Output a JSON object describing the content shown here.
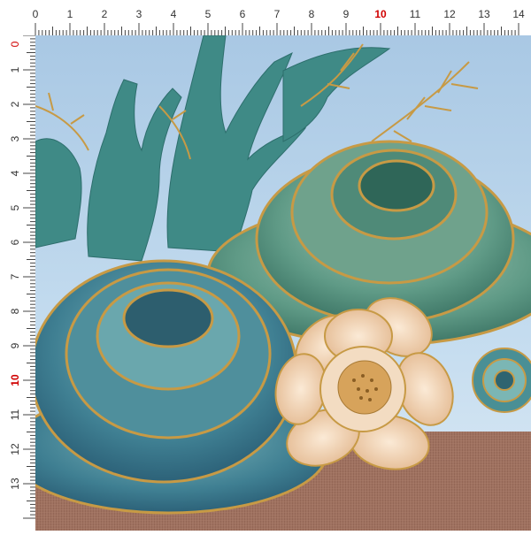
{
  "ruler": {
    "unit": "cm",
    "top_labels": [
      "0",
      "1",
      "2",
      "3",
      "4",
      "5",
      "6",
      "7",
      "8",
      "9",
      "10",
      "11",
      "12",
      "13",
      "14"
    ],
    "left_labels": [
      "0",
      "1",
      "2",
      "3",
      "4",
      "5",
      "6",
      "7",
      "8",
      "9",
      "10",
      "11",
      "12",
      "13"
    ],
    "highlight_label": "10",
    "highlight_color": "#d00000"
  },
  "artwork": {
    "subject": "watercolor coral and teal flowers with gold outlines",
    "colors": {
      "sky": "#b9d4ea",
      "coral": "#3e8a86",
      "teal_flower": "#4e8f9c",
      "green_flower": "#6ea58f",
      "peach_flower": "#f1d9bd",
      "gold": "#c79a45",
      "burlap": "#9b6c5c"
    }
  }
}
